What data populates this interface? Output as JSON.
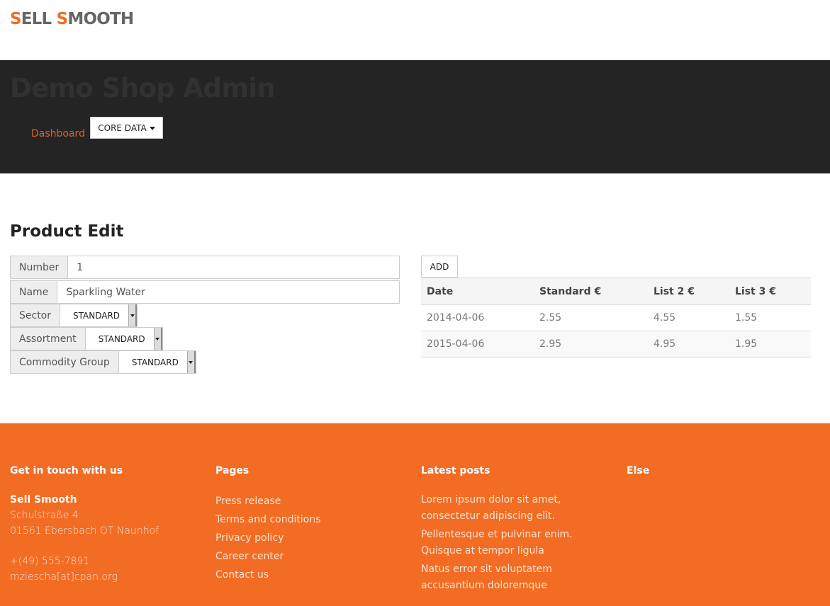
{
  "logo": {
    "part1_accent": "S",
    "part1_rest": "ELL ",
    "part2_accent": "S",
    "part2_rest": "MOOTH"
  },
  "hero": {
    "title": "Demo Shop Admin",
    "nav_dashboard": "Dashboard",
    "nav_core_data": "CORE DATA"
  },
  "page_title": "Product Edit",
  "form": {
    "number": {
      "label": "Number",
      "value": "1"
    },
    "name": {
      "label": "Name",
      "value": "Sparkling Water"
    },
    "sector": {
      "label": "Sector",
      "value": "STANDARD"
    },
    "assortment": {
      "label": "Assortment",
      "value": "STANDARD"
    },
    "commodity_group": {
      "label": "Commodity Group",
      "value": "STANDARD"
    }
  },
  "prices": {
    "add_label": "ADD",
    "headers": [
      "Date",
      "Standard €",
      "List 2 €",
      "List 3 €"
    ],
    "rows": [
      [
        "2014-04-06",
        "2.55",
        "4.55",
        "1.55"
      ],
      [
        "2015-04-06",
        "2.95",
        "4.95",
        "1.95"
      ]
    ]
  },
  "footer": {
    "contact": {
      "heading": "Get in touch with us",
      "company": "Sell Smooth",
      "street": "Schulstraße 4",
      "city": "01561 Ebersbach OT Naunhof",
      "phone": "+(49) 555-7891",
      "email": "mziescha[at]cpan.org"
    },
    "pages": {
      "heading": "Pages",
      "links": [
        "Press release",
        "Terms and conditions",
        "Privacy policy",
        "Career center",
        "Contact us"
      ]
    },
    "posts": {
      "heading": "Latest posts",
      "items": [
        "Lorem ipsum dolor sit amet, consectetur adipiscing elit.",
        "Pellentesque et pulvinar enim. Quisque at tempor ligula",
        "Natus error sit voluptatem accusantium doloremque"
      ]
    },
    "else": {
      "heading": "Else"
    }
  },
  "colors": {
    "accent": "#f26c23",
    "hero_bg": "#242424"
  }
}
